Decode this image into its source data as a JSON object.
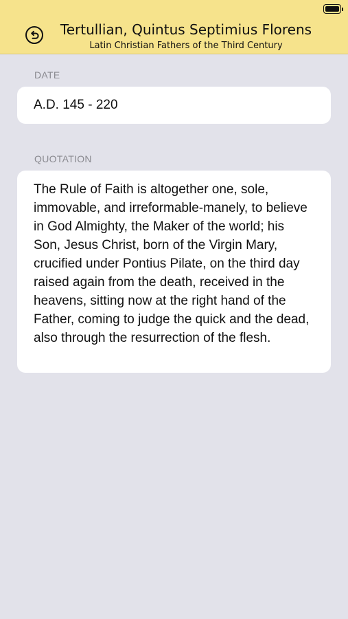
{
  "status_bar": {
    "battery_level": 1.0
  },
  "header": {
    "title": "Tertullian, Quintus Septimius Florens",
    "subtitle": "Latin Christian Fathers of the Third Century",
    "back_icon": "back-arrow-circle-icon"
  },
  "date_section": {
    "label": "DATE",
    "value": "A.D. 145 - 220"
  },
  "quotation_section": {
    "label": "QUOTATION",
    "text": "The Rule of Faith is altogether one, sole, immovable, and irreformable-manely, to believe in God Almighty, the Maker of the world; his Son, Jesus Christ, born of the Virgin Mary, crucified under Pontius Pilate, on the third day raised again from the death, received in the heavens, sitting now at the right hand of the Father, coming to judge the quick and the dead, also through the resurrection of the flesh."
  },
  "colors": {
    "header_background": "#f6e38c",
    "page_background": "#e2e2ea",
    "card_background": "#ffffff",
    "label_color": "#8a8a90"
  }
}
